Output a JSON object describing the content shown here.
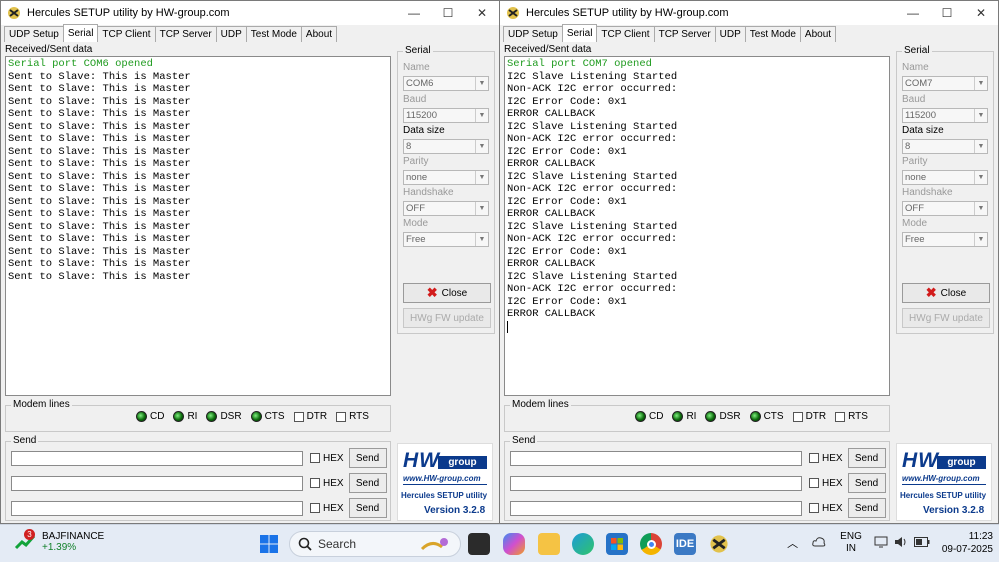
{
  "windows": [
    {
      "id": "left",
      "title": "Hercules SETUP utility by HW-group.com",
      "tabs": [
        "UDP Setup",
        "Serial",
        "TCP Client",
        "TCP Server",
        "UDP",
        "Test Mode",
        "About"
      ],
      "active_tab": "Serial",
      "received_label": "Received/Sent data",
      "lines": [
        {
          "text": "Serial port COM6 opened",
          "color": "#1f9b1f"
        },
        {
          "text": "Sent to Slave: This is Master"
        },
        {
          "text": "Sent to Slave: This is Master"
        },
        {
          "text": "Sent to Slave: This is Master"
        },
        {
          "text": "Sent to Slave: This is Master"
        },
        {
          "text": "Sent to Slave: This is Master"
        },
        {
          "text": "Sent to Slave: This is Master"
        },
        {
          "text": "Sent to Slave: This is Master"
        },
        {
          "text": "Sent to Slave: This is Master"
        },
        {
          "text": "Sent to Slave: This is Master"
        },
        {
          "text": "Sent to Slave: This is Master"
        },
        {
          "text": "Sent to Slave: This is Master"
        },
        {
          "text": "Sent to Slave: This is Master"
        },
        {
          "text": "Sent to Slave: This is Master"
        },
        {
          "text": "Sent to Slave: This is Master"
        },
        {
          "text": "Sent to Slave: This is Master"
        },
        {
          "text": "Sent to Slave: This is Master"
        },
        {
          "text": "Sent to Slave: This is Master"
        }
      ],
      "serial": {
        "group_title": "Serial",
        "name_label": "Name",
        "name_value": "COM6",
        "baud_label": "Baud",
        "baud_value": "115200",
        "datasize_label": "Data size",
        "datasize_value": "8",
        "parity_label": "Parity",
        "parity_value": "none",
        "handshake_label": "Handshake",
        "handshake_value": "OFF",
        "mode_label": "Mode",
        "mode_value": "Free",
        "close_label": "Close",
        "fw_label": "HWg FW update"
      },
      "modem": {
        "title": "Modem lines",
        "leds": [
          "CD",
          "RI",
          "DSR",
          "CTS"
        ],
        "checks": [
          "DTR",
          "RTS"
        ]
      },
      "send": {
        "title": "Send",
        "hex_label": "HEX",
        "button": "Send"
      },
      "logo": {
        "hw": "HW",
        "group": "group",
        "url": "www.HW-group.com",
        "app": "Hercules SETUP utility",
        "version": "Version  3.2.8"
      }
    },
    {
      "id": "right",
      "title": "Hercules SETUP utility by HW-group.com",
      "tabs": [
        "UDP Setup",
        "Serial",
        "TCP Client",
        "TCP Server",
        "UDP",
        "Test Mode",
        "About"
      ],
      "active_tab": "Serial",
      "received_label": "Received/Sent data",
      "lines": [
        {
          "text": "Serial port COM7 opened",
          "color": "#1f9b1f"
        },
        {
          "text": "I2C Slave Listening Started"
        },
        {
          "text": "Non-ACK I2C error occurred:"
        },
        {
          "text": "I2C Error Code: 0x1"
        },
        {
          "text": "ERROR CALLBACK"
        },
        {
          "text": "I2C Slave Listening Started"
        },
        {
          "text": "Non-ACK I2C error occurred:"
        },
        {
          "text": "I2C Error Code: 0x1"
        },
        {
          "text": "ERROR CALLBACK"
        },
        {
          "text": "I2C Slave Listening Started"
        },
        {
          "text": "Non-ACK I2C error occurred:"
        },
        {
          "text": "I2C Error Code: 0x1"
        },
        {
          "text": "ERROR CALLBACK"
        },
        {
          "text": "I2C Slave Listening Started"
        },
        {
          "text": "Non-ACK I2C error occurred:"
        },
        {
          "text": "I2C Error Code: 0x1"
        },
        {
          "text": "ERROR CALLBACK"
        },
        {
          "text": "I2C Slave Listening Started"
        },
        {
          "text": "Non-ACK I2C error occurred:"
        },
        {
          "text": "I2C Error Code: 0x1"
        },
        {
          "text": "ERROR CALLBACK"
        }
      ],
      "serial": {
        "group_title": "Serial",
        "name_label": "Name",
        "name_value": "COM7",
        "baud_label": "Baud",
        "baud_value": "115200",
        "datasize_label": "Data size",
        "datasize_value": "8",
        "parity_label": "Parity",
        "parity_value": "none",
        "handshake_label": "Handshake",
        "handshake_value": "OFF",
        "mode_label": "Mode",
        "mode_value": "Free",
        "close_label": "Close",
        "fw_label": "HWg FW update"
      },
      "modem": {
        "title": "Modem lines",
        "leds": [
          "CD",
          "RI",
          "DSR",
          "CTS"
        ],
        "checks": [
          "DTR",
          "RTS"
        ]
      },
      "send": {
        "title": "Send",
        "hex_label": "HEX",
        "button": "Send"
      },
      "logo": {
        "hw": "HW",
        "group": "group",
        "url": "www.HW-group.com",
        "app": "Hercules SETUP utility",
        "version": "Version  3.2.8"
      }
    }
  ],
  "window_controls": {
    "minimize": "—",
    "maximize": "☐",
    "close": "✕"
  },
  "taskbar": {
    "stock_badge": "3",
    "stock_name": "BAJFINANCE",
    "stock_change": "+1.39%",
    "search_placeholder": "Search",
    "ide_label": "IDE",
    "lang_line1": "ENG",
    "lang_line2": "IN",
    "time": "11:23",
    "date": "09-07-2025",
    "icons": [
      "windows-start-icon",
      "task-view-icon",
      "copilot-icon",
      "file-explorer-icon",
      "edge-icon",
      "store-icon",
      "chrome-icon",
      "stm32-ide-icon",
      "hercules-icon"
    ]
  }
}
